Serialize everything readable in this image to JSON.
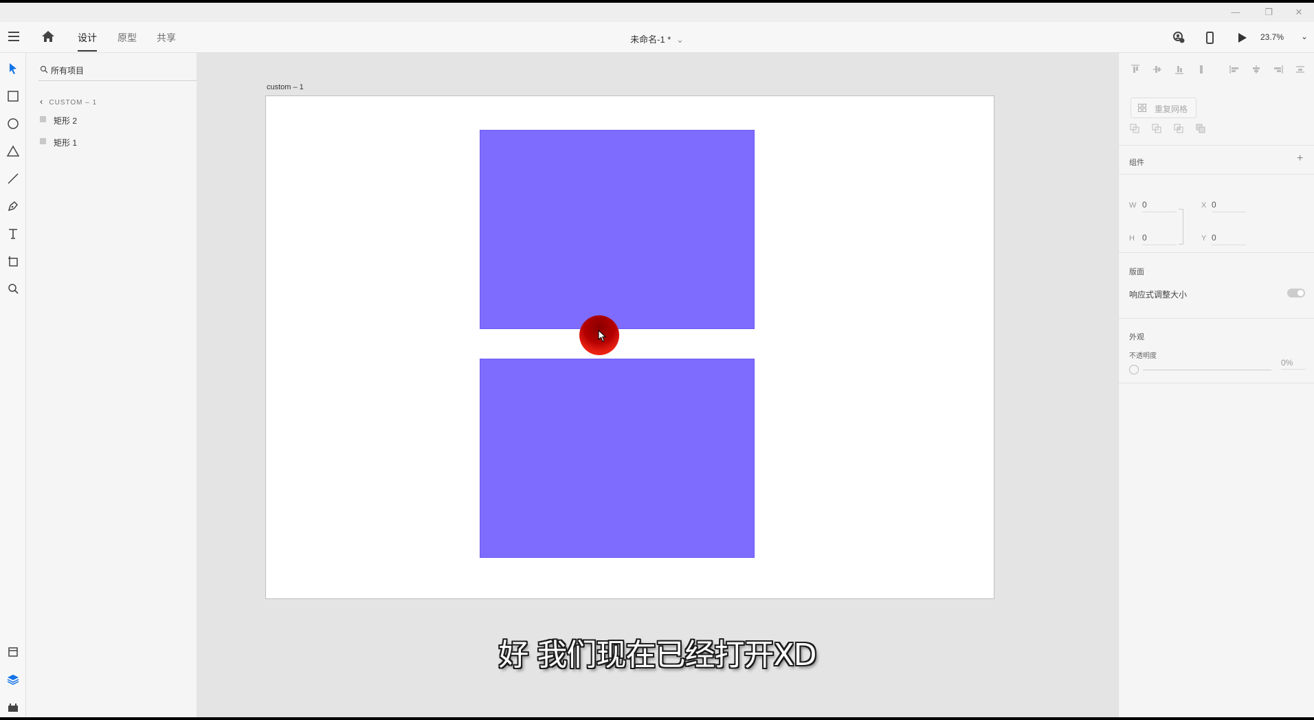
{
  "header": {
    "tabs": [
      {
        "label": "设计",
        "active": true
      },
      {
        "label": "原型",
        "active": false
      },
      {
        "label": "共享",
        "active": false
      }
    ],
    "doc_title": "未命名-1 *",
    "doc_chevron": "⌄",
    "zoom": "23.7%",
    "zoom_chevron": "⌄"
  },
  "window_controls": {
    "minimize": "—",
    "restore": "❐",
    "close": "✕"
  },
  "layers": {
    "filter_label": "所有项目",
    "breadcrumb": "CUSTOM – 1",
    "items": [
      {
        "label": "矩形 2"
      },
      {
        "label": "矩形 1"
      }
    ]
  },
  "canvas": {
    "artboard_label": "custom – 1",
    "subtitle": "好 我们现在已经打开XD",
    "shape_color": "#7e6cff"
  },
  "inspector": {
    "repeat_grid": "重复网格",
    "component_title": "组件",
    "add": "+",
    "w_label": "W",
    "w_value": "0",
    "h_label": "H",
    "h_value": "0",
    "x_label": "X",
    "x_value": "0",
    "y_label": "Y",
    "y_value": "0",
    "artboard_title": "版面",
    "responsive_resize": "响应式调整大小",
    "appearance_title": "外观",
    "opacity_label": "不透明度",
    "opacity_value": "0%"
  },
  "icons": {
    "hamburger": "menu-icon",
    "home": "home-icon",
    "share_user": "user-share-icon",
    "device": "mobile-device-icon",
    "play": "play-icon"
  }
}
